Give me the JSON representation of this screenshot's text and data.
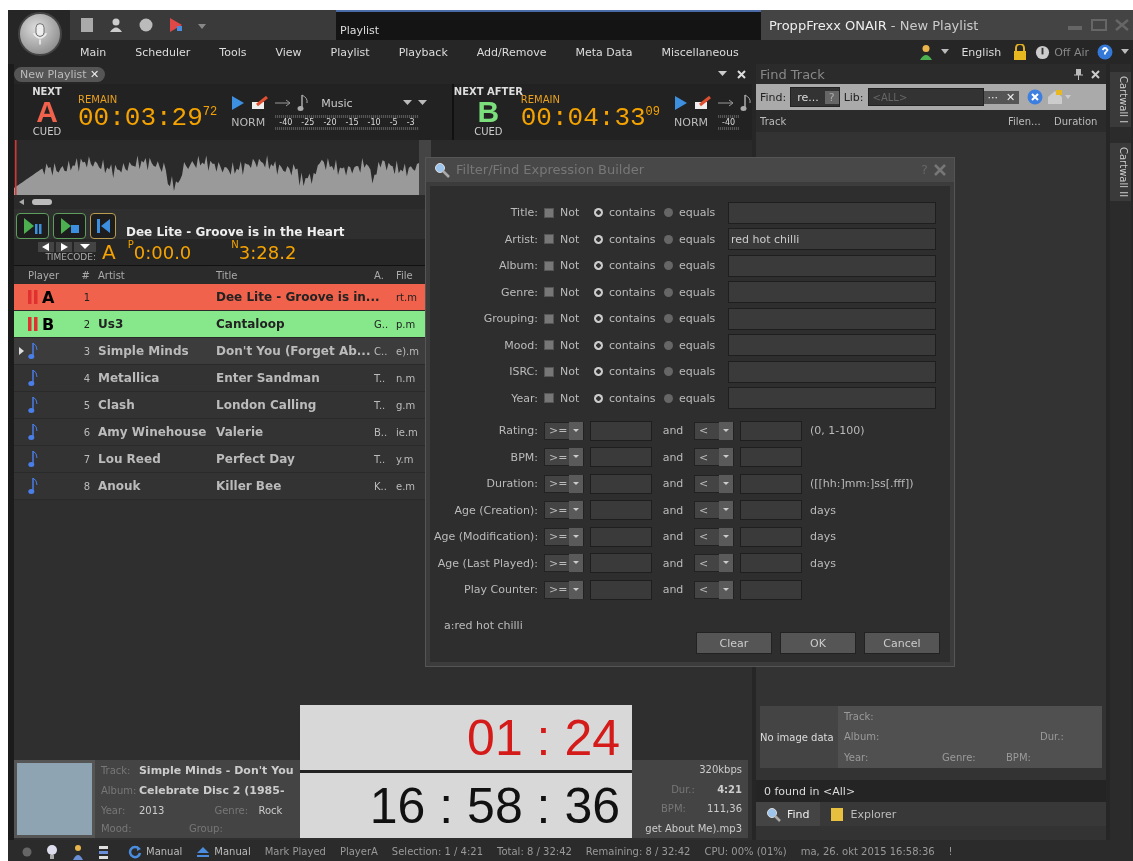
{
  "window": {
    "title": "ProppFrexx ONAIR",
    "document": " - New Playlist",
    "ribbon_tab": "Playlist"
  },
  "menu": [
    "Main",
    "Scheduler",
    "Tools",
    "View",
    "Playlist",
    "Playback",
    "Add/Remove",
    "Meta Data",
    "Miscellaneous"
  ],
  "toolbar_right": {
    "language": "English",
    "on_air": "Off Air"
  },
  "playlist_tab": {
    "label": "New Playlist",
    "close": "✕"
  },
  "decks": [
    {
      "caption": "NEXT",
      "letter": "A",
      "color": "#f0624b",
      "status": "CUED",
      "remain_label": "REMAIN",
      "time": "00:03:29",
      "frames": "72",
      "mode": "NORM",
      "category": "Music",
      "scale": [
        "-40",
        "-25",
        "-20",
        "-15",
        "-10",
        "-5",
        "-3"
      ]
    },
    {
      "caption": "NEXT AFTER",
      "letter": "B",
      "color": "#7be07b",
      "status": "CUED",
      "remain_label": "REMAIN",
      "time": "00:04:33",
      "frames": "09",
      "mode": "NORM",
      "scale": [
        "-40"
      ]
    }
  ],
  "now_title": "Dee Lite - Groove is in the Heart",
  "timecode": {
    "label": "TIMECODE:",
    "player": "A",
    "p_mark": "P",
    "position": "0:00.0",
    "n_mark": "N",
    "remaining": "3:28.2"
  },
  "table": {
    "columns": [
      "Player",
      "#",
      "Artist",
      "Title",
      "A.",
      "File"
    ],
    "rows": [
      {
        "kind": "deck",
        "player": "A",
        "color": "#f0624b",
        "selected": false,
        "num": "1",
        "title": "Dee Lite - Groove is in...",
        "file": "rt.m"
      },
      {
        "kind": "deck",
        "player": "B",
        "color": "#86e88a",
        "selected": false,
        "num": "2",
        "artist": "Us3",
        "title": "Cantaloop",
        "album": "G..",
        "file": "p.m"
      },
      {
        "kind": "track",
        "selected": true,
        "num": "3",
        "artist": "Simple Minds",
        "title": "Don't You (Forget Ab...",
        "album": "C..",
        "file": "e).m"
      },
      {
        "kind": "track",
        "selected": false,
        "num": "4",
        "artist": "Metallica",
        "title": "Enter Sandman",
        "album": "T..",
        "file": "n.m"
      },
      {
        "kind": "track",
        "selected": false,
        "num": "5",
        "artist": "Clash",
        "title": "London Calling",
        "album": "T..",
        "file": "g.m"
      },
      {
        "kind": "track",
        "selected": false,
        "num": "6",
        "artist": "Amy Winehouse",
        "title": "Valerie",
        "album": "B..",
        "file": "ie.m"
      },
      {
        "kind": "track",
        "selected": false,
        "num": "7",
        "artist": "Lou Reed",
        "title": "Perfect Day",
        "album": "T..",
        "file": "y.m"
      },
      {
        "kind": "track",
        "selected": false,
        "num": "8",
        "artist": "Anouk",
        "title": "Killer Bee",
        "album": "K..",
        "file": "e.m"
      }
    ]
  },
  "now_playing": {
    "fields": [
      {
        "label": "Track:",
        "value": "Simple Minds - Don't You"
      },
      {
        "label": "Album:",
        "value": "Celebrate Disc 2 (1985-"
      },
      {
        "label": "Year:",
        "value": "2013",
        "label2": "Genre:",
        "value2": "Rock"
      },
      {
        "label": "Mood:",
        "label2": "Group:"
      }
    ],
    "right": [
      {
        "value": "320kbps"
      },
      {
        "label": "Dur.:",
        "value": "4:21"
      },
      {
        "label": "BPM:",
        "value": "111,36"
      },
      {
        "value": "get About Me).mp3"
      }
    ]
  },
  "find_panel": {
    "title": "Find Track",
    "find_label": "Find:",
    "find_value": "re...",
    "help": "?",
    "lib_label": "Lib:",
    "lib_placeholder": "<ALL>",
    "browse": "···",
    "clear": "✕",
    "columns": [
      "Track",
      "Filen...",
      "Duration"
    ],
    "no_image": "No image data",
    "info_labels": [
      [
        "Track:"
      ],
      [
        "Album:",
        "Dur.:"
      ],
      [
        "Year:",
        "Genre:",
        "BPM:"
      ]
    ],
    "found": "0 found in <All>",
    "tabs": [
      {
        "label": "Find",
        "selected": true
      },
      {
        "label": "Explorer",
        "selected": false
      }
    ]
  },
  "cartwall_tabs": [
    "Cartwall I",
    "Cartwall II"
  ],
  "dialog": {
    "title": "Filter/Find Expression Builder",
    "help": "?",
    "text_rows": [
      {
        "label": "Title:",
        "not": {
          "label": "Not",
          "checked": false
        },
        "options": [
          {
            "label": "contains",
            "selected": true
          },
          {
            "label": "equals",
            "selected": false
          }
        ]
      },
      {
        "label": "Artist:",
        "not": {
          "label": "Not",
          "checked": false
        },
        "options": [
          {
            "label": "contains",
            "selected": true
          },
          {
            "label": "equals",
            "selected": false
          }
        ],
        "value": "red hot chilli"
      },
      {
        "label": "Album:",
        "not": {
          "label": "Not",
          "checked": false
        },
        "options": [
          {
            "label": "contains",
            "selected": true
          },
          {
            "label": "equals",
            "selected": false
          }
        ]
      },
      {
        "label": "Genre:",
        "not": {
          "label": "Not",
          "checked": false
        },
        "options": [
          {
            "label": "contains",
            "selected": true
          },
          {
            "label": "equals",
            "selected": false
          }
        ]
      },
      {
        "label": "Grouping:",
        "not": {
          "label": "Not",
          "checked": false
        },
        "options": [
          {
            "label": "contains",
            "selected": true
          },
          {
            "label": "equals",
            "selected": false
          }
        ]
      },
      {
        "label": "Mood:",
        "not": {
          "label": "Not",
          "checked": false
        },
        "options": [
          {
            "label": "contains",
            "selected": true
          },
          {
            "label": "equals",
            "selected": false
          }
        ]
      },
      {
        "label": "ISRC:",
        "not": {
          "label": "Not",
          "checked": false
        },
        "options": [
          {
            "label": "contains",
            "selected": true
          },
          {
            "label": "equals",
            "selected": false
          }
        ]
      },
      {
        "label": "Year:",
        "not": {
          "label": "Not",
          "checked": false
        },
        "options": [
          {
            "label": "contains",
            "selected": true
          },
          {
            "label": "equals",
            "selected": false
          }
        ]
      }
    ],
    "range_rows": [
      {
        "label": "Rating:",
        "op1": ">=",
        "and": "and",
        "op2": "<",
        "hint": "(0, 1-100)"
      },
      {
        "label": "BPM:",
        "op1": ">=",
        "and": "and",
        "op2": "<"
      },
      {
        "label": "Duration:",
        "op1": ">=",
        "and": "and",
        "op2": "<",
        "hint": "([[hh:]mm:]ss[.fff])"
      },
      {
        "label": "Age (Creation):",
        "op1": ">=",
        "and": "and",
        "op2": "<",
        "hint": "days"
      },
      {
        "label": "Age (Modification):",
        "op1": ">=",
        "and": "and",
        "op2": "<",
        "hint": "days"
      },
      {
        "label": "Age (Last Played):",
        "op1": ">=",
        "and": "and",
        "op2": "<",
        "hint": "days"
      },
      {
        "label": "Play Counter:",
        "op1": ">=",
        "and": "and",
        "op2": "<"
      }
    ],
    "expression": "a:red hot chilli",
    "buttons": [
      "Clear",
      "OK",
      "Cancel"
    ]
  },
  "clock": {
    "countdown": "01 : 24",
    "time": "16 : 58 : 36"
  },
  "status_bar": {
    "mode_buttons": [
      "Manual",
      "Manual"
    ],
    "texts": [
      "Mark Played",
      "PlayerA",
      "Selection: 1 / 4:21",
      "Total: 8 / 32:42",
      "Remaining: 8 / 32:42",
      "CPU: 00% (01%)",
      "ma, 26. okt 2015 16:58:36",
      "!"
    ]
  }
}
